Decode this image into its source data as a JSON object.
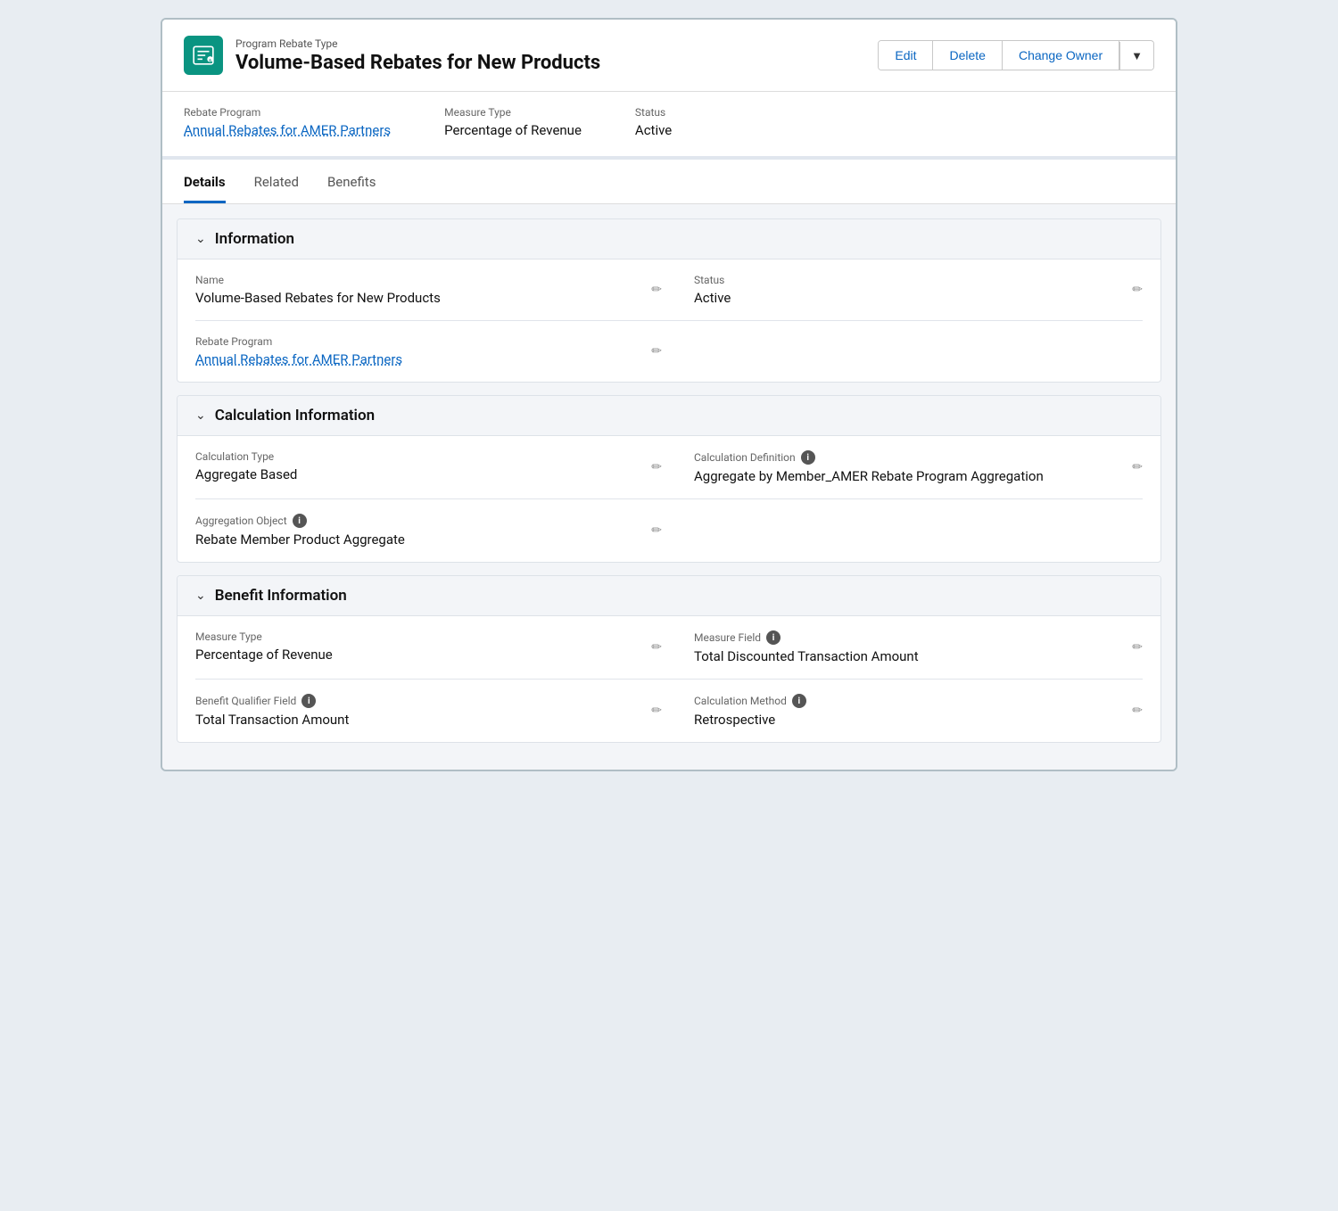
{
  "header": {
    "subtitle": "Program Rebate Type",
    "title": "Volume-Based Rebates for New Products",
    "buttons": {
      "edit": "Edit",
      "delete": "Delete",
      "changeOwner": "Change Owner"
    }
  },
  "infoBar": {
    "rebateProgram": {
      "label": "Rebate Program",
      "value": "Annual Rebates for AMER Partners"
    },
    "measureType": {
      "label": "Measure Type",
      "value": "Percentage of Revenue"
    },
    "status": {
      "label": "Status",
      "value": "Active"
    }
  },
  "tabs": [
    {
      "id": "details",
      "label": "Details",
      "active": true
    },
    {
      "id": "related",
      "label": "Related",
      "active": false
    },
    {
      "id": "benefits",
      "label": "Benefits",
      "active": false
    }
  ],
  "sections": {
    "information": {
      "title": "Information",
      "fields": {
        "name": {
          "label": "Name",
          "value": "Volume-Based Rebates for New Products"
        },
        "status": {
          "label": "Status",
          "value": "Active"
        },
        "rebateProgram": {
          "label": "Rebate Program",
          "value": "Annual Rebates for AMER Partners",
          "isLink": true
        }
      }
    },
    "calculationInformation": {
      "title": "Calculation Information",
      "fields": {
        "calculationType": {
          "label": "Calculation Type",
          "value": "Aggregate Based"
        },
        "calculationDefinition": {
          "label": "Calculation Definition",
          "value": "Aggregate by Member_AMER Rebate Program Aggregation",
          "hasInfo": true
        },
        "aggregationObject": {
          "label": "Aggregation Object",
          "value": "Rebate Member Product Aggregate",
          "hasInfo": true
        }
      }
    },
    "benefitInformation": {
      "title": "Benefit Information",
      "fields": {
        "measureType": {
          "label": "Measure Type",
          "value": "Percentage of Revenue"
        },
        "measureField": {
          "label": "Measure Field",
          "value": "Total Discounted Transaction Amount",
          "hasInfo": true
        },
        "benefitQualifierField": {
          "label": "Benefit Qualifier Field",
          "value": "Total Transaction Amount",
          "hasInfo": true
        },
        "calculationMethod": {
          "label": "Calculation Method",
          "value": "Retrospective",
          "hasInfo": true
        }
      }
    }
  }
}
